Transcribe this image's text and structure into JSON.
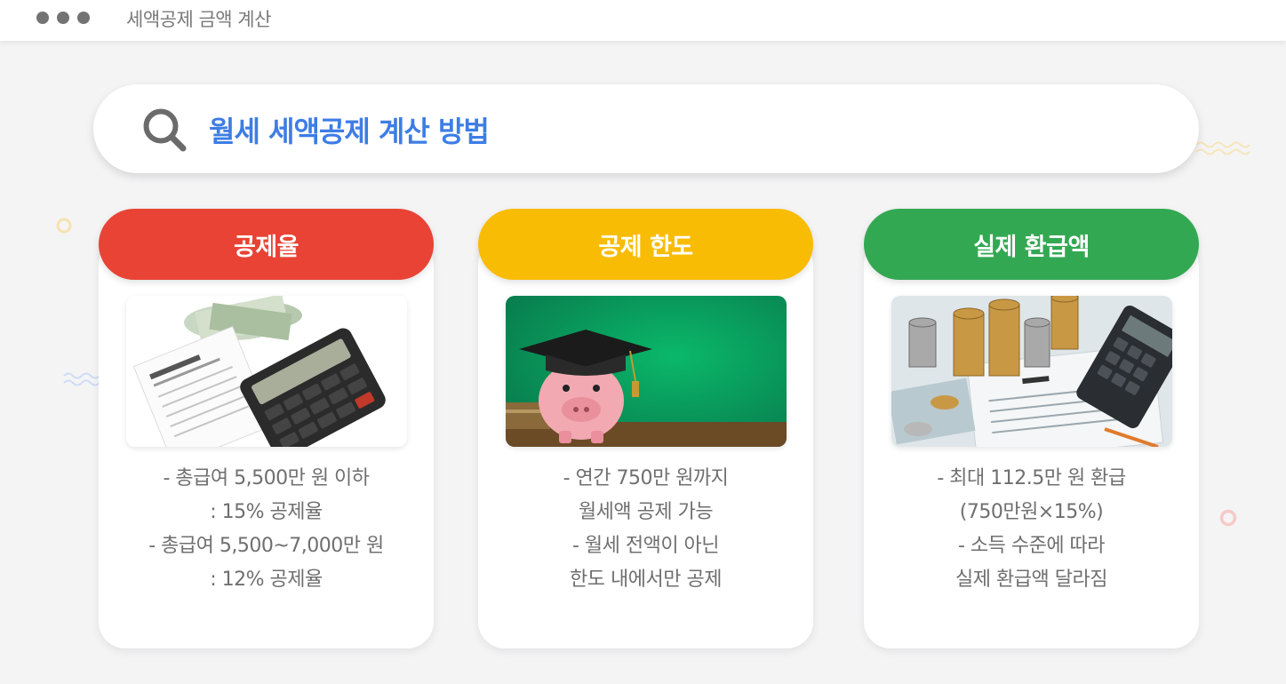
{
  "window": {
    "title": "세액공제 금액 계산"
  },
  "search": {
    "query": "월세 세액공제 계산 방법"
  },
  "colors": {
    "red": "#e84335",
    "yellow": "#f9bc05",
    "green": "#33a853",
    "query_blue": "#3d7de5"
  },
  "cards": [
    {
      "title": "공제율",
      "image": "calculator-tax-credit-form",
      "lines": [
        "- 총급여 5,500만 원 이하",
        ": 15% 공제율",
        "- 총급여 5,500~7,000만 원",
        ": 12% 공제율"
      ]
    },
    {
      "title": "공제 한도",
      "image": "piggy-bank-graduation-cap",
      "lines": [
        "- 연간 750만 원까지",
        "월세액 공제 가능",
        "- 월세 전액이 아닌",
        "한도 내에서만 공제"
      ]
    },
    {
      "title": "실제 환급액",
      "image": "coins-calculator-tax-form",
      "lines": [
        "- 최대 112.5만 원 환급",
        "(750만원×15%)",
        "- 소득 수준에 따라",
        "실제 환급액 달라짐"
      ]
    }
  ]
}
